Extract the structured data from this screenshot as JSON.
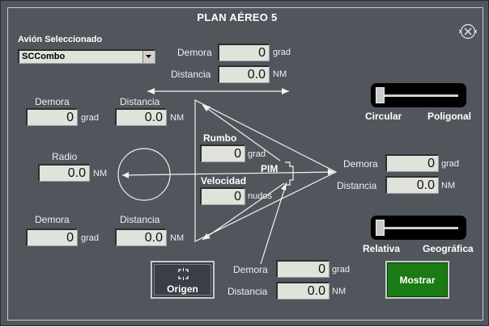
{
  "window": {
    "title": "PLAN AÉREO 5"
  },
  "selector": {
    "label": "Avión Seleccionado",
    "value": "SCCombo"
  },
  "top": {
    "demora_label": "Demora",
    "demora_value": "0",
    "demora_unit": "grad",
    "distancia_label": "Distancia",
    "distancia_value": "0.0",
    "distancia_unit": "NM"
  },
  "left_upper": {
    "demora_label": "Demora",
    "demora_value": "0",
    "demora_unit": "grad",
    "distancia_label": "Distancia",
    "distancia_value": "0.0",
    "distancia_unit": "NM"
  },
  "radio": {
    "label": "Radio",
    "value": "0.0",
    "unit": "NM"
  },
  "left_lower": {
    "demora_label": "Demora",
    "demora_value": "0",
    "demora_unit": "grad",
    "distancia_label": "Distancia",
    "distancia_value": "0.0",
    "distancia_unit": "NM"
  },
  "center": {
    "rumbo_label": "Rumbo",
    "rumbo_value": "0",
    "rumbo_unit": "grad",
    "velocidad_label": "Velocidad",
    "velocidad_value": "0",
    "velocidad_unit": "nudos",
    "pim_label": "PIM"
  },
  "right": {
    "demora_label": "Demora",
    "demora_value": "0",
    "demora_unit": "grad",
    "distancia_label": "Distancia",
    "distancia_value": "0.0",
    "distancia_unit": "NM"
  },
  "bottom": {
    "demora_label": "Demora",
    "demora_value": "0",
    "demora_unit": "grad",
    "distancia_label": "Distancia",
    "distancia_value": "0.0",
    "distancia_unit": "NM"
  },
  "toggle_shape": {
    "left_label": "Circular",
    "right_label": "Poligonal",
    "selected": "Circular"
  },
  "toggle_ref": {
    "left_label": "Relativa",
    "right_label": "Geográfica",
    "selected": "Relativa"
  },
  "buttons": {
    "origen": "Origen",
    "mostrar": "Mostrar"
  },
  "colors": {
    "panel": "#50565c",
    "mostrar": "#1a7a14",
    "field": "#dfe3d9"
  }
}
